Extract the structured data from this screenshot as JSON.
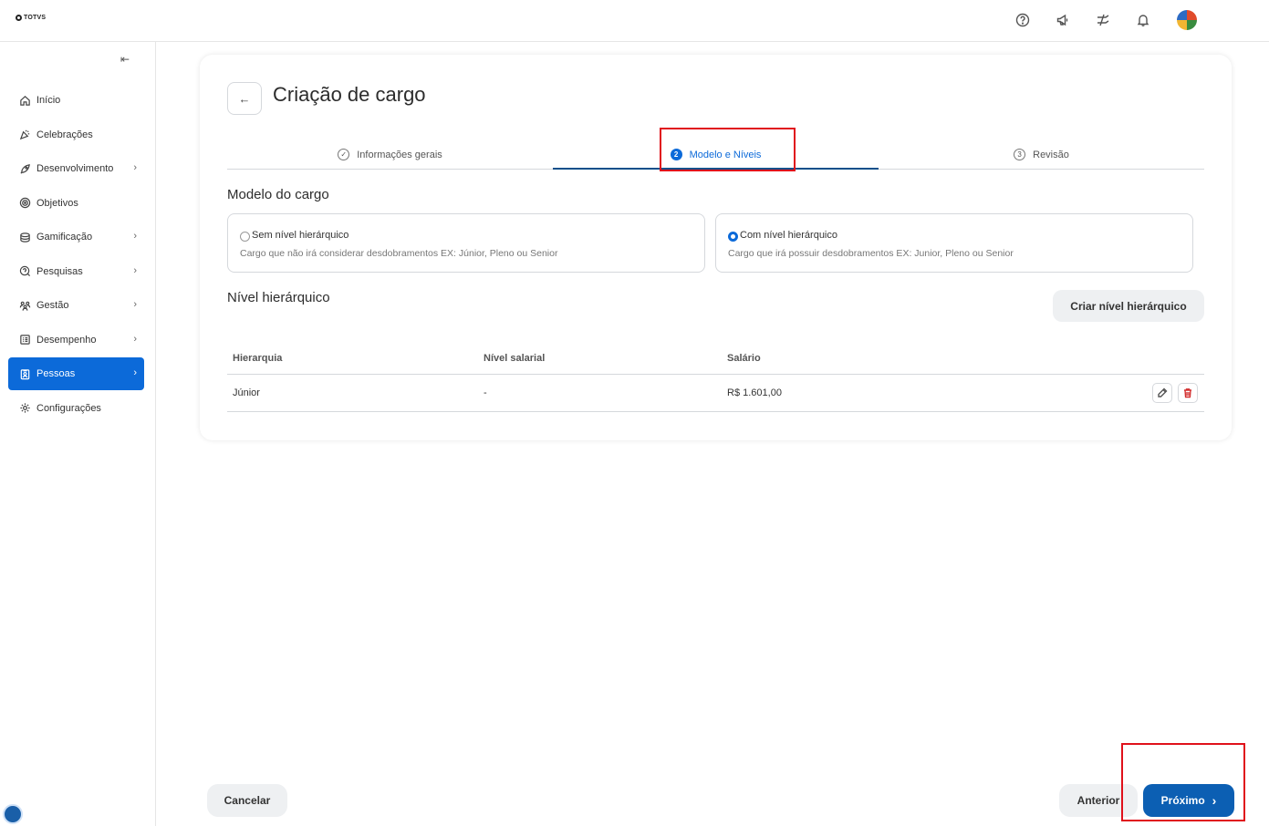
{
  "brand": {
    "logo_text": "TOTVS"
  },
  "topbar": {
    "icons": [
      "help-icon",
      "megaphone-icon",
      "integration-icon",
      "bell-icon"
    ],
    "avatar": "user-avatar"
  },
  "sidebar": {
    "collapse_icon": "⇤",
    "items": [
      {
        "label": "Início",
        "icon": "home-icon",
        "has_children": false,
        "active": false
      },
      {
        "label": "Celebrações",
        "icon": "party-icon",
        "has_children": false,
        "active": false
      },
      {
        "label": "Desenvolvimento",
        "icon": "rocket-icon",
        "has_children": true,
        "active": false
      },
      {
        "label": "Objetivos",
        "icon": "target-icon",
        "has_children": false,
        "active": false
      },
      {
        "label": "Gamificação",
        "icon": "gamification-icon",
        "has_children": true,
        "active": false
      },
      {
        "label": "Pesquisas",
        "icon": "survey-icon",
        "has_children": true,
        "active": false
      },
      {
        "label": "Gestão",
        "icon": "team-icon",
        "has_children": true,
        "active": false
      },
      {
        "label": "Desempenho",
        "icon": "performance-icon",
        "has_children": true,
        "active": false
      },
      {
        "label": "Pessoas",
        "icon": "badge-icon",
        "has_children": true,
        "active": true
      },
      {
        "label": "Configurações",
        "icon": "gear-icon",
        "has_children": false,
        "active": false
      }
    ]
  },
  "page": {
    "title": "Criação de cargo",
    "back_icon": "←",
    "steps": [
      {
        "number": "✓",
        "label": "Informações gerais",
        "state": "done"
      },
      {
        "number": "2",
        "label": "Modelo e Níveis",
        "state": "active"
      },
      {
        "number": "3",
        "label": "Revisão",
        "state": "pending"
      }
    ]
  },
  "model": {
    "title": "Modelo do cargo",
    "options": [
      {
        "title": "Sem nível hierárquico",
        "description": "Cargo que não irá considerar desdobramentos EX: Júnior, Pleno ou Senior",
        "selected": false
      },
      {
        "title": "Com nível hierárquico",
        "description": "Cargo que irá possuir desdobramentos EX: Junior, Pleno ou Senior",
        "selected": true
      }
    ]
  },
  "levels": {
    "title": "Nível hierárquico",
    "create_button": "Criar nível hierárquico",
    "columns": [
      "Hierarquia",
      "Nível salarial",
      "Salário"
    ],
    "rows": [
      {
        "hierarquia": "Júnior",
        "nivel_salarial": "-",
        "salario": "R$ 1.601,00"
      }
    ]
  },
  "footer": {
    "cancel": "Cancelar",
    "previous": "Anterior",
    "next": "Próximo",
    "next_icon": "›"
  },
  "colors": {
    "primary": "#0c6ad9",
    "primary_dark": "#0c5fb3",
    "highlight": "#e0111b",
    "danger": "#d32f2f"
  }
}
